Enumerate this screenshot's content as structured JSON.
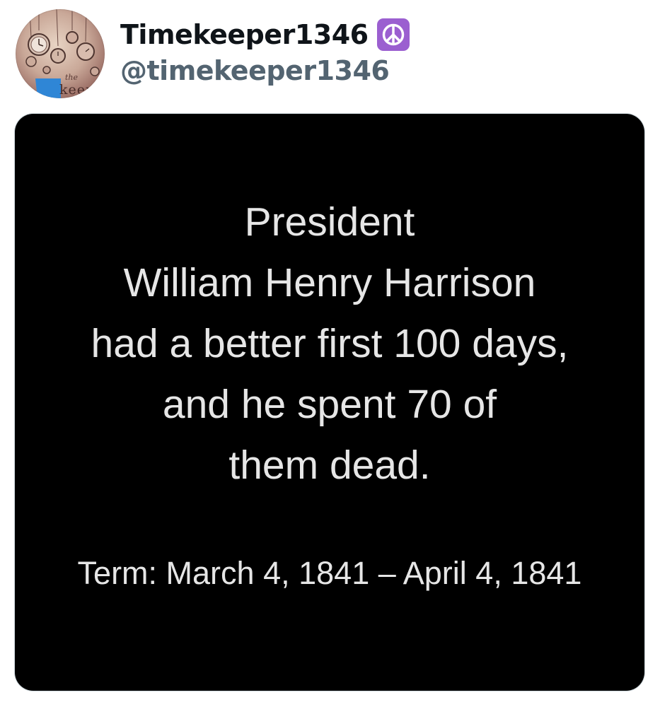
{
  "post": {
    "author": {
      "display_name": "Timekeeper1346",
      "handle": "@timekeeper1346",
      "badge_icon": "peace-symbol-icon",
      "avatar": {
        "text_small": "the",
        "text_large": "keepe"
      }
    },
    "media": {
      "quote_lines": [
        "President",
        "William Henry Harrison",
        "had a better first 100 days,",
        "and he spent 70 of",
        "them dead."
      ],
      "term": "Term: March 4, 1841 – April 4, 1841"
    }
  },
  "colors": {
    "name": "#0f1419",
    "handle": "#536471",
    "card_bg": "#000000",
    "card_text": "#e6e6e6",
    "badge_bg": "#9b5fd0"
  }
}
